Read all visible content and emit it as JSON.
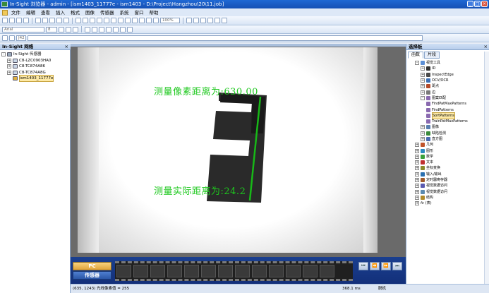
{
  "window": {
    "title": "In-Sight 浏览器 - admin - [ism1403_11777e - ism1403 - D:\\Project\\Hangzhou\\20\\11.job]",
    "controls": [
      "_",
      "□",
      "×"
    ]
  },
  "menu": [
    "文件",
    "编辑",
    "查看",
    "插入",
    "格式",
    "图像",
    "传感器",
    "系统",
    "窗口",
    "帮助"
  ],
  "toolbar": {
    "zoom_value": "100%",
    "font_name": "Arial",
    "font_size": "8",
    "cell_ref": "J42"
  },
  "left_panel": {
    "title": "In-Sight 网络",
    "close": "×",
    "tree": [
      {
        "label": "In-Sight 传感器",
        "level": 0,
        "expander": "-"
      },
      {
        "label": "C8-LZC0903HA0",
        "level": 1,
        "expander": "+"
      },
      {
        "label": "C8-TC874A86",
        "level": 1,
        "expander": "+"
      },
      {
        "label": "C8-TC874A8G",
        "level": 1,
        "expander": "+"
      },
      {
        "label": "ism1403_11777e",
        "level": 1,
        "expander": "",
        "selected": true
      }
    ]
  },
  "image_view": {
    "overlay_pixel_label": "测量像素距离为:",
    "overlay_pixel_value": "630.00",
    "overlay_actual_label": "测量实际距离为:",
    "overlay_actual_value": "24.2",
    "overlay_color": "#1ec81e"
  },
  "filmstrip": {
    "pc_button": "PC",
    "sensor_button": "传感器",
    "nav": [
      "⏮",
      "⏪",
      "⏩",
      "⏭"
    ]
  },
  "status_bar": {
    "coords": "(635, 1243)",
    "exposure_text": "光线像素值 = 255",
    "time": "368.1 ms",
    "mode": "脱机"
  },
  "right_panel": {
    "title": "选择板",
    "close": "×",
    "tabs": [
      "函数",
      "片段"
    ],
    "tree": [
      {
        "label": "视觉工具",
        "level": 0,
        "expander": "-",
        "color": "#5c8fd6"
      },
      {
        "label": "ID",
        "level": 1,
        "expander": "+",
        "color": "#333333"
      },
      {
        "label": "InspectEdge",
        "level": 1,
        "expander": "+",
        "color": "#4a4a4a"
      },
      {
        "label": "OCV/OCR",
        "level": 1,
        "expander": "+",
        "color": "#3c6fb5"
      },
      {
        "label": "斑点",
        "level": 1,
        "expander": "+",
        "color": "#b44a2a"
      },
      {
        "label": "边",
        "level": 1,
        "expander": "+",
        "color": "#7a7a7a"
      },
      {
        "label": "图案匹配",
        "level": 1,
        "expander": "-",
        "color": "#8a6ab0"
      },
      {
        "label": "FindPatMaxPatterns",
        "level": 2,
        "expander": "",
        "color": "#8a6ab0"
      },
      {
        "label": "FindPatterns",
        "level": 2,
        "expander": "",
        "color": "#8a6ab0"
      },
      {
        "label": "SortPatterns",
        "level": 2,
        "expander": "",
        "color": "#8a6ab0",
        "selected": true
      },
      {
        "label": "TrainPatMaxPatterns",
        "level": 2,
        "expander": "",
        "color": "#8a6ab0"
      },
      {
        "label": "图像",
        "level": 1,
        "expander": "+",
        "color": "#5a7fb0"
      },
      {
        "label": "缺陷检测",
        "level": 1,
        "expander": "+",
        "color": "#3a8a3a"
      },
      {
        "label": "直方图",
        "level": 1,
        "expander": "+",
        "color": "#4a6ab0"
      },
      {
        "label": "几何",
        "level": 0,
        "expander": "+",
        "color": "#c0542a"
      },
      {
        "label": "图形",
        "level": 0,
        "expander": "+",
        "color": "#2a8ac0"
      },
      {
        "label": "数学",
        "level": 0,
        "expander": "+",
        "color": "#3aa03a"
      },
      {
        "label": "文本",
        "level": 0,
        "expander": "+",
        "color": "#c03030"
      },
      {
        "label": "坐标变换",
        "level": 0,
        "expander": "+",
        "color": "#8a8a2a"
      },
      {
        "label": "输入/输出",
        "level": 0,
        "expander": "+",
        "color": "#2a70b0"
      },
      {
        "label": "定时器寄存器",
        "level": 0,
        "expander": "+",
        "color": "#a05a2a"
      },
      {
        "label": "视觉数据访问",
        "level": 0,
        "expander": "+",
        "color": "#5a5ab0"
      },
      {
        "label": "视觉数据访问",
        "level": 0,
        "expander": "+",
        "color": "#5a8ab0"
      },
      {
        "label": "结构",
        "level": 0,
        "expander": "+",
        "color": "#b08a2a"
      },
      {
        "label": "(表)",
        "level": 0,
        "expander": "+",
        "color": "#666666",
        "prefix": "fx"
      }
    ]
  }
}
